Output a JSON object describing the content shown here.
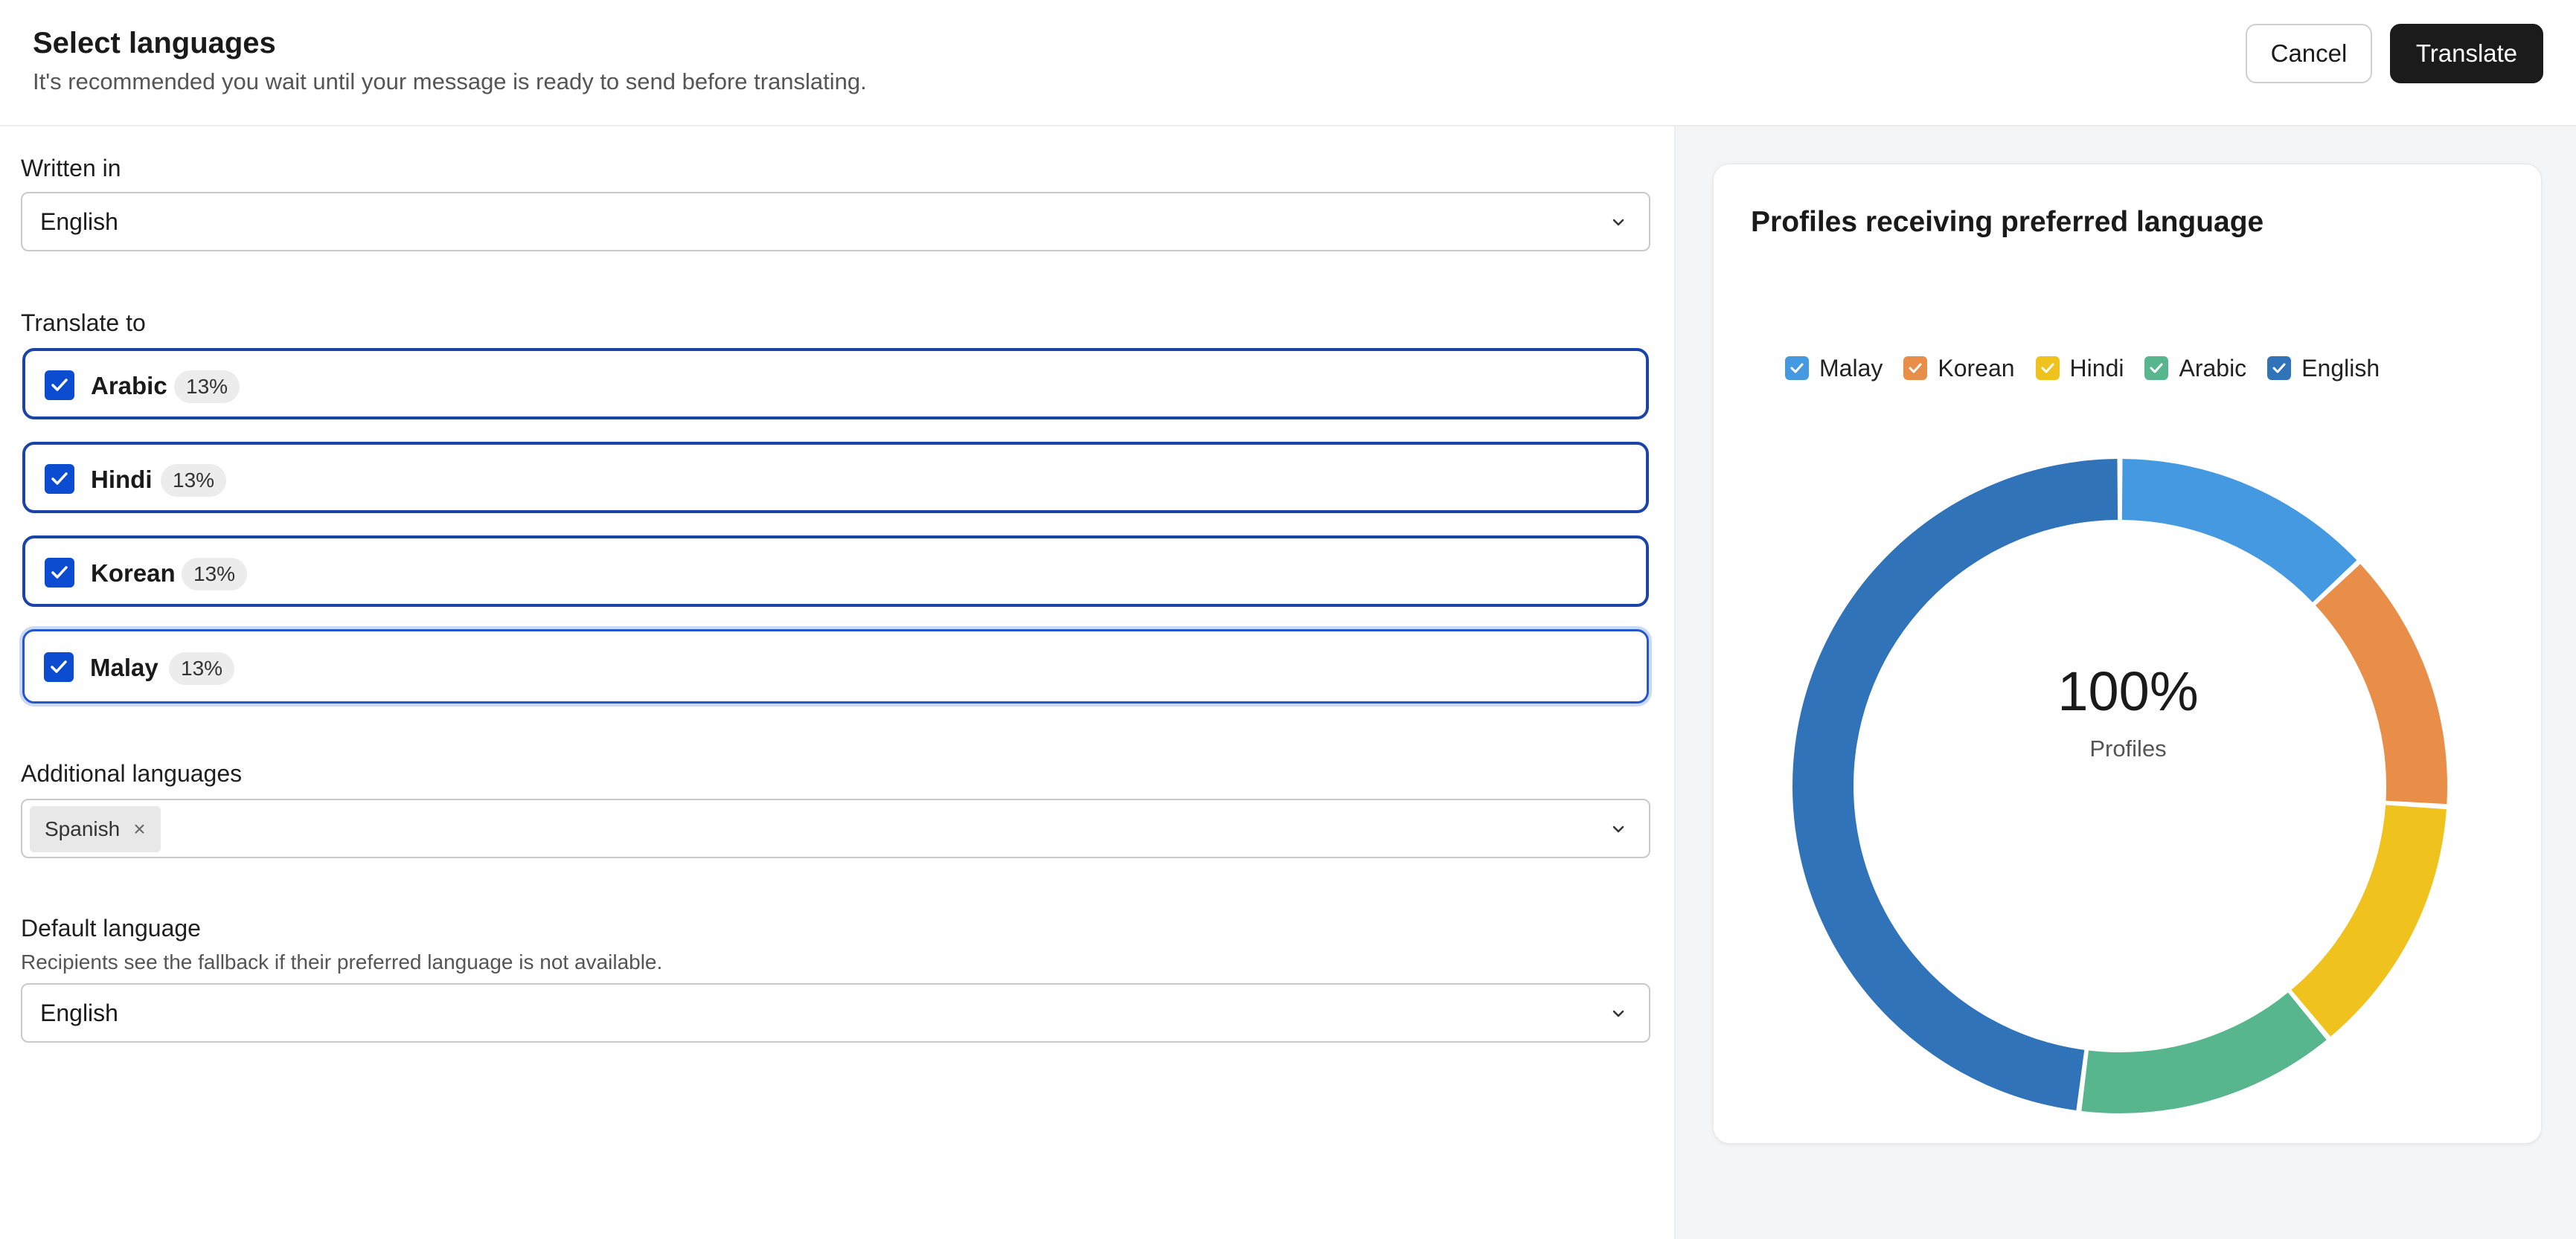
{
  "header": {
    "title": "Select languages",
    "subtitle": "It's recommended you wait until your message is ready to send before translating.",
    "cancel_label": "Cancel",
    "translate_label": "Translate"
  },
  "form": {
    "written_in": {
      "label": "Written in",
      "value": "English"
    },
    "translate_to": {
      "label": "Translate to",
      "languages": [
        {
          "name": "Arabic",
          "percent": "13%",
          "checked": true
        },
        {
          "name": "Hindi",
          "percent": "13%",
          "checked": true
        },
        {
          "name": "Korean",
          "percent": "13%",
          "checked": true
        },
        {
          "name": "Malay",
          "percent": "13%",
          "checked": true
        }
      ]
    },
    "additional": {
      "label": "Additional languages",
      "chip": "Spanish",
      "chip_remove": "×"
    },
    "default_language": {
      "label": "Default language",
      "helper": "Recipients see the fallback if their preferred language is not available.",
      "value": "English"
    }
  },
  "panel": {
    "title": "Profiles receiving preferred language",
    "center_value": "100%",
    "center_label": "Profiles"
  },
  "chart_data": {
    "type": "pie",
    "variant": "donut",
    "legend": "top",
    "series": [
      {
        "name": "Malay",
        "value": 13,
        "color": "#4499e0"
      },
      {
        "name": "Korean",
        "value": 13,
        "color": "#e88e48"
      },
      {
        "name": "Hindi",
        "value": 13,
        "color": "#f0c21e"
      },
      {
        "name": "Arabic",
        "value": 13,
        "color": "#58b68e"
      },
      {
        "name": "English",
        "value": 48,
        "color": "#3173b9"
      }
    ]
  }
}
